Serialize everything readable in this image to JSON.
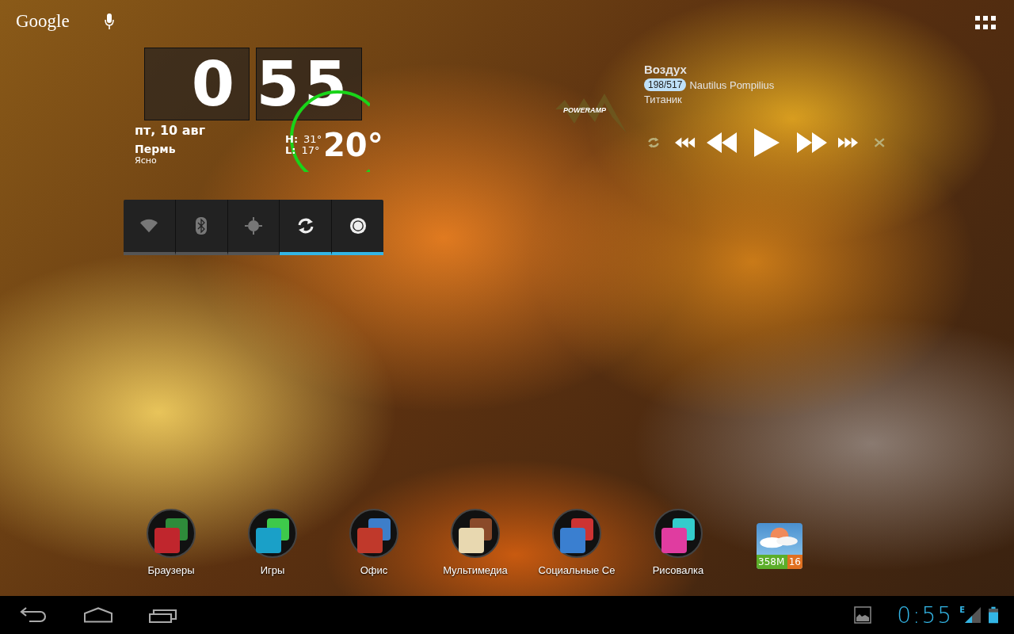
{
  "search_bar": {
    "label": "Google"
  },
  "clock": {
    "hours": "0",
    "minutes": "55",
    "date": "пт, 10 авг",
    "city": "Пермь",
    "condition": "Ясно",
    "high_label": "H:",
    "high": "31°",
    "low_label": "L:",
    "low": "17°",
    "temperature": "20°"
  },
  "player": {
    "title": "Воздух",
    "counter": "198/517",
    "artist": "Nautilus Pompilius",
    "album": "Титаник",
    "logo": "POWERAMP"
  },
  "toggles": [
    {
      "kind": "wifi",
      "on": false
    },
    {
      "kind": "bluetooth",
      "on": false
    },
    {
      "kind": "gps",
      "on": false
    },
    {
      "kind": "sync",
      "on": true
    },
    {
      "kind": "brightness",
      "on": true
    }
  ],
  "dock": [
    {
      "kind": "folder",
      "label": "Браузеры"
    },
    {
      "kind": "folder",
      "label": "Игры"
    },
    {
      "kind": "folder",
      "label": "Офис"
    },
    {
      "kind": "folder",
      "label": "Мультимедиа"
    },
    {
      "kind": "folder",
      "label": "Социальные Се"
    },
    {
      "kind": "folder",
      "label": "Рисовалка"
    },
    {
      "kind": "app",
      "badges": [
        "358M",
        "16"
      ]
    }
  ],
  "nav_bar": {
    "time": "0:55",
    "network": "E"
  }
}
